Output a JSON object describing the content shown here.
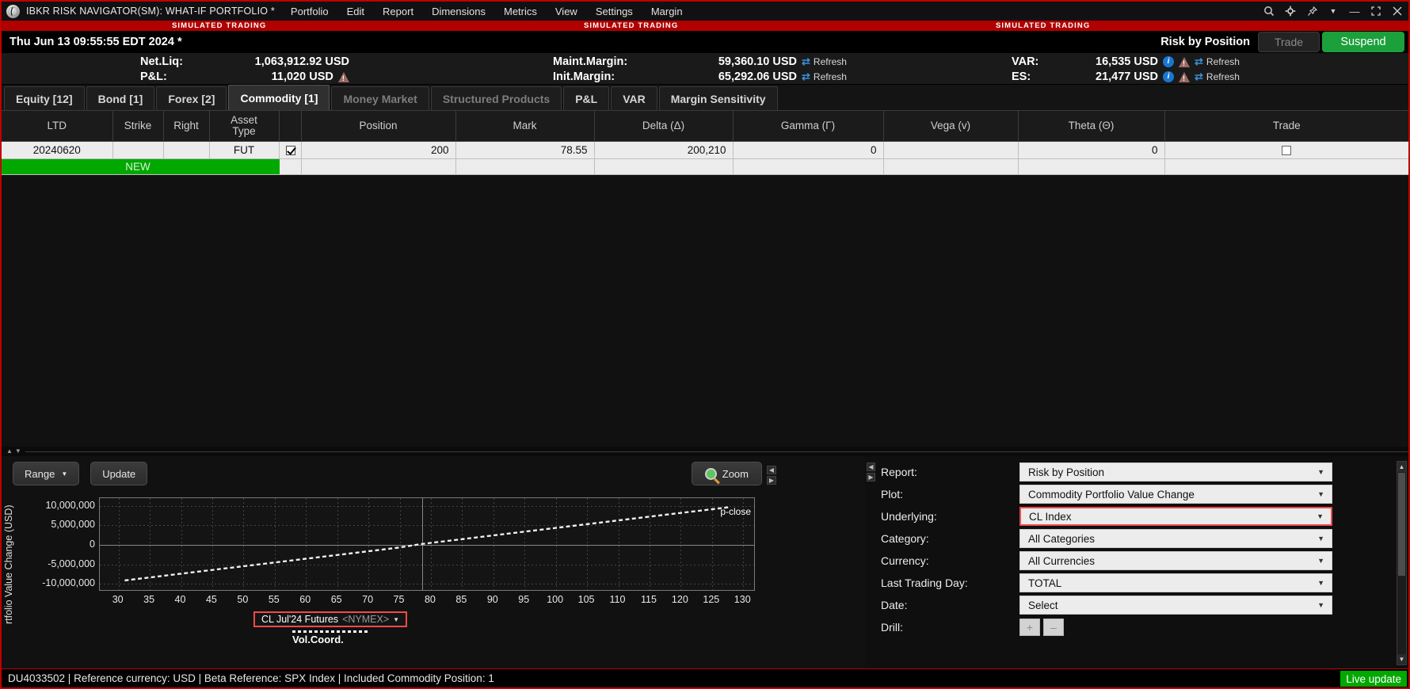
{
  "window": {
    "title": "IBKR RISK NAVIGATOR(SM): WHAT-IF PORTFOLIO *",
    "logo_icon": "ibkr-logo-icon",
    "menus": [
      "Portfolio",
      "Edit",
      "Report",
      "Dimensions",
      "Metrics",
      "View",
      "Settings",
      "Margin"
    ],
    "controls": [
      {
        "name": "search-icon",
        "glyph": "⌕"
      },
      {
        "name": "gear-icon",
        "glyph": "⚙"
      },
      {
        "name": "pin-icon",
        "glyph": "✐"
      },
      {
        "name": "chevron-down-icon",
        "glyph": "▼"
      },
      {
        "name": "minimize-icon",
        "glyph": "—"
      },
      {
        "name": "maximize-icon",
        "glyph": "⛶"
      },
      {
        "name": "close-icon",
        "glyph": "✕"
      }
    ]
  },
  "sim_banner": {
    "text": "SIMULATED TRADING",
    "color": "#b00000"
  },
  "header": {
    "datetime": "Thu Jun 13 09:55:55 EDT 2024 *",
    "report_title": "Risk by Position",
    "trade_button": "Trade",
    "suspend_button": "Suspend",
    "suspend_color": "#1ba03c",
    "stats": {
      "netliq_label": "Net.Liq:",
      "netliq_value": "1,063,912.92 USD",
      "pnl_label": "P&L:",
      "pnl_value": "11,020 USD",
      "maint_label": "Maint.Margin:",
      "maint_value": "59,360.10 USD",
      "init_label": "Init.Margin:",
      "init_value": "65,292.06 USD",
      "var_label": "VAR:",
      "var_value": "16,535 USD",
      "es_label": "ES:",
      "es_value": "21,477 USD",
      "refresh_label": "Refresh"
    }
  },
  "tabs": [
    {
      "label": "Equity [12]",
      "state": "normal"
    },
    {
      "label": "Bond [1]",
      "state": "normal"
    },
    {
      "label": "Forex [2]",
      "state": "normal"
    },
    {
      "label": "Commodity [1]",
      "state": "active"
    },
    {
      "label": "Money Market",
      "state": "dim"
    },
    {
      "label": "Structured Products",
      "state": "dim"
    },
    {
      "label": "P&L",
      "state": "normal"
    },
    {
      "label": "VAR",
      "state": "normal"
    },
    {
      "label": "Margin Sensitivity",
      "state": "normal"
    }
  ],
  "table": {
    "columns": [
      "LTD",
      "Strike",
      "Right",
      "Asset Type",
      "",
      "Position",
      "Mark",
      "Delta (Δ)",
      "Gamma (Γ)",
      "Vega (v)",
      "Theta (Θ)",
      "Trade"
    ],
    "rows": [
      {
        "ltd": "20240620",
        "strike": "",
        "right": "",
        "asset_type": "FUT",
        "include": true,
        "position": "200",
        "mark": "78.55",
        "delta": "200,210",
        "gamma": "0",
        "vega": "",
        "theta": "0",
        "trade_checked": false
      }
    ],
    "new_row_label": "NEW",
    "new_row_color": "#00a800"
  },
  "chart_panel": {
    "range_button": "Range",
    "update_button": "Update",
    "zoom_button": "Zoom",
    "zoom_icon": "magnifier-icon"
  },
  "chart_data": {
    "type": "line",
    "title": "",
    "xlabel": "CL Jul'24 Futures <NYMEX>",
    "ylabel": "rtfolio Value Change (USD)",
    "ylabel_full": "Portfolio Value Change (USD)",
    "series": [
      {
        "name": "p-close",
        "x": [
          31,
          35,
          40,
          45,
          50,
          55,
          60,
          65,
          70,
          75,
          78.55,
          80,
          85,
          90,
          95,
          100,
          105,
          110,
          115,
          120,
          125,
          128
        ],
        "y": [
          -9500000,
          -8720000,
          -7740000,
          -6770000,
          -5790000,
          -4820000,
          -3840000,
          -2870000,
          -1890000,
          -910000,
          0,
          290000,
          1260000,
          2240000,
          3210000,
          4190000,
          5160000,
          6140000,
          7110000,
          8090000,
          9060000,
          9650000
        ]
      }
    ],
    "yticks": [
      10000000,
      5000000,
      0,
      -5000000,
      -10000000
    ],
    "ytick_labels": [
      "10,000,000",
      "5,000,000",
      "0",
      "-5,000,000",
      "-10,000,000"
    ],
    "ylim": [
      -12000000,
      12000000
    ],
    "xticks": [
      30,
      35,
      40,
      45,
      50,
      55,
      60,
      65,
      70,
      75,
      80,
      85,
      90,
      95,
      100,
      105,
      110,
      115,
      120,
      125,
      130
    ],
    "xlim": [
      27,
      132
    ],
    "marker_x": 78.55,
    "grid": true,
    "annotation": "p-close",
    "vol_coord_label": "Vol.Coord.",
    "x_selector": {
      "text": "CL Jul'24 Futures",
      "exchange": "<NYMEX>"
    }
  },
  "form": {
    "rows": [
      {
        "label": "Report:",
        "value": "Risk by Position",
        "highlight": false
      },
      {
        "label": "Plot:",
        "value": "Commodity Portfolio Value Change",
        "highlight": false
      },
      {
        "label": "Underlying:",
        "value": "CL Index",
        "highlight": true
      },
      {
        "label": "Category:",
        "value": "All Categories",
        "highlight": false
      },
      {
        "label": "Currency:",
        "value": "All Currencies",
        "highlight": false
      },
      {
        "label": "Last Trading Day:",
        "value": "TOTAL",
        "highlight": false
      },
      {
        "label": "Date:",
        "value": "Select",
        "highlight": false
      }
    ],
    "drill_label": "Drill:",
    "drill_plus": "+",
    "drill_minus": "–"
  },
  "status": {
    "text": "DU4033502  |  Reference currency: USD  |  Beta Reference:  SPX Index  |  Included Commodity Position: 1",
    "live_update": "Live update",
    "live_color": "#00a800"
  }
}
